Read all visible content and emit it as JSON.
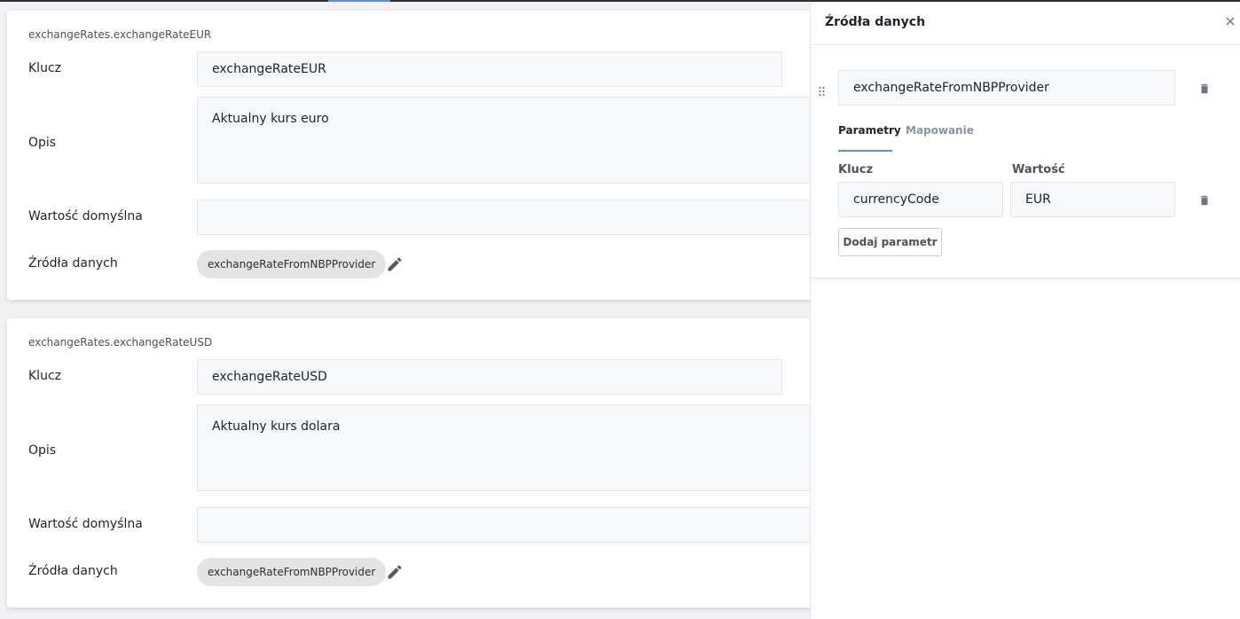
{
  "variables": [
    {
      "path": "exchangeRates.exchangeRateEUR",
      "key_label": "Klucz",
      "key_value": "exchangeRateEUR",
      "description_label": "Opis",
      "description_value": "Aktualny kurs euro",
      "default_label": "Wartość domyślna",
      "default_value": "",
      "sources_label": "Źródła danych",
      "source_chip": "exchangeRateFromNBPProvider"
    },
    {
      "path": "exchangeRates.exchangeRateUSD",
      "key_label": "Klucz",
      "key_value": "exchangeRateUSD",
      "description_label": "Opis",
      "description_value": "Aktualny kurs dolara",
      "default_label": "Wartość domyślna",
      "default_value": "",
      "sources_label": "Źródła danych",
      "source_chip": "exchangeRateFromNBPProvider"
    }
  ],
  "panel": {
    "title": "Źródła danych",
    "close_icon": "close-icon",
    "provider": "exchangeRateFromNBPProvider",
    "tabs": [
      {
        "label": "Parametry",
        "active": true
      },
      {
        "label": "Mapowanie",
        "active": false
      }
    ],
    "param_key_header": "Klucz",
    "param_value_header": "Wartość",
    "params": [
      {
        "key": "currencyCode",
        "value": "EUR"
      }
    ],
    "add_param_label": "Dodaj parametr"
  },
  "colors": {
    "accent": "#5b8def",
    "field_bg": "#f7f8fa",
    "chip_bg": "#e4e4e4"
  }
}
